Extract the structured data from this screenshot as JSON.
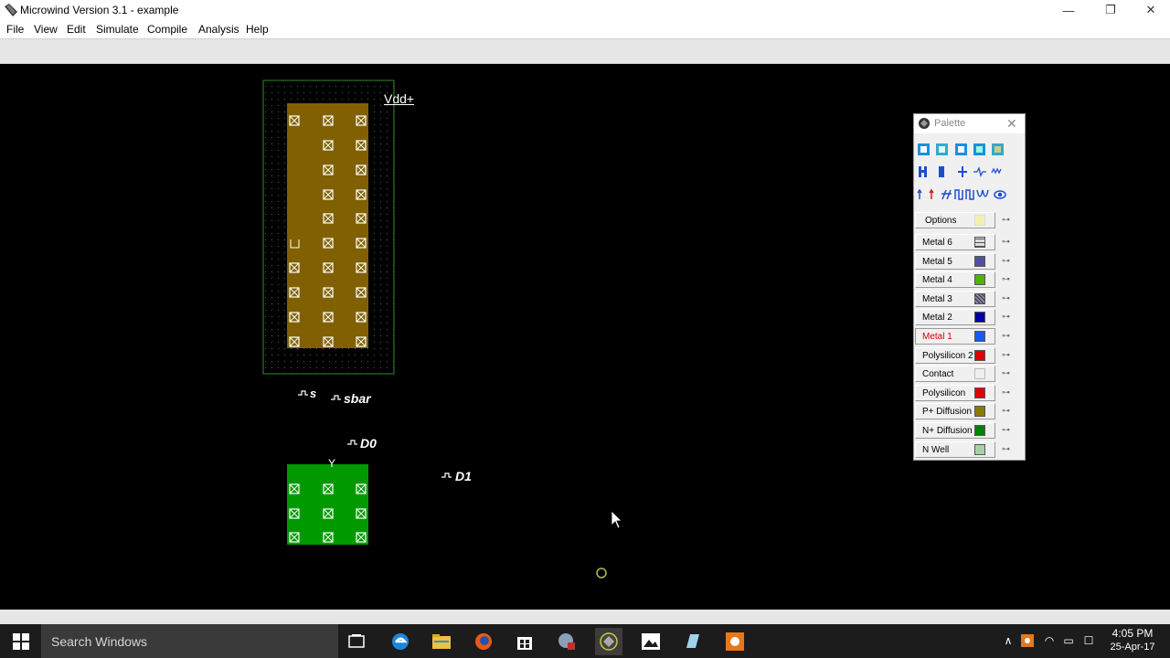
{
  "window": {
    "title": "Microwind Version 3.1 - example",
    "minimize": "—",
    "maximize": "❐",
    "close": "✕"
  },
  "menu": [
    "File",
    "View",
    "Edit",
    "Simulate",
    "Compile",
    "Analysis",
    "Help"
  ],
  "canvas": {
    "labels": {
      "vdd": "Vdd+",
      "s": "s",
      "sbar": "sbar",
      "d0": "D0",
      "d1": "D1",
      "y": "Y"
    },
    "colors": {
      "pdiff": "#806000",
      "ndiff": "#009900",
      "nwell_border": "#2e8b2e",
      "contact": "#ffffff"
    }
  },
  "palette": {
    "title": "Palette",
    "close": "✕",
    "option_row": {
      "label": "Options"
    },
    "layers": [
      {
        "label": "Metal 6",
        "color": "#c8c8c8",
        "icon": "grid-swatch"
      },
      {
        "label": "Metal 5",
        "color": "#4f4fa0"
      },
      {
        "label": "Metal 4",
        "color": "#55b000"
      },
      {
        "label": "Metal 3",
        "color": "#6f6f8f",
        "icon": "hatch-swatch"
      },
      {
        "label": "Metal 2",
        "color": "#0000a0"
      },
      {
        "label": "Metal 1",
        "color": "#1a58f0",
        "selected": true
      },
      {
        "label": "Polysilicon 2",
        "color": "#e00000"
      },
      {
        "label": "Contact",
        "color": "#e0e0e0",
        "icon": "contact-swatch"
      },
      {
        "label": "Polysilicon",
        "color": "#e00000"
      },
      {
        "label": "P+ Diffusion",
        "color": "#8a7a00"
      },
      {
        "label": "N+ Diffusion",
        "color": "#008000"
      },
      {
        "label": "N Well",
        "color": "#a8d0a8"
      }
    ]
  },
  "taskbar": {
    "search_placeholder": "Search Windows",
    "time": "4:05 PM",
    "date": "25-Apr-17"
  }
}
